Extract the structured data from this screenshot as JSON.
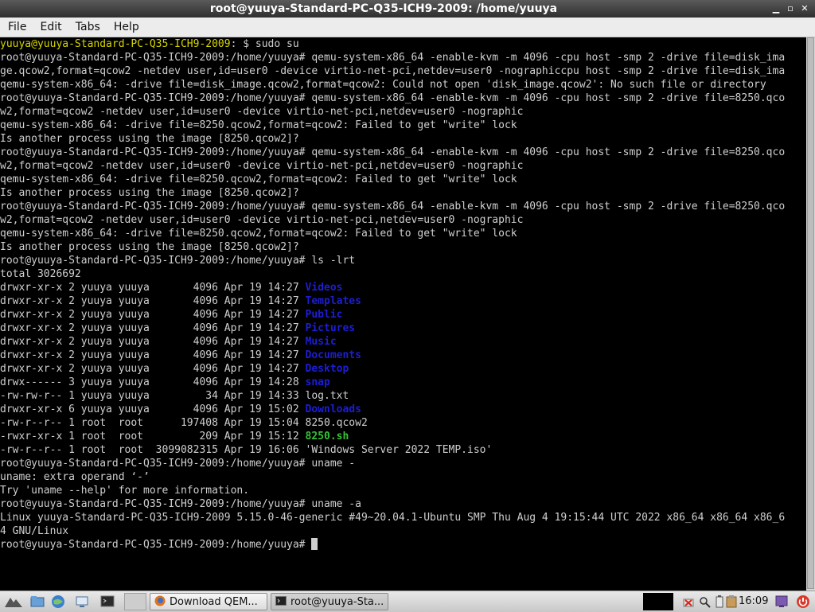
{
  "window": {
    "title": "root@yuuya-Standard-PC-Q35-ICH9-2009: /home/yuuya"
  },
  "menu": {
    "file": "File",
    "edit": "Edit",
    "tabs": "Tabs",
    "help": "Help"
  },
  "terminal": {
    "user_prompt_user": "yuuya@yuuya-Standard-PC-Q35-ICH9-2009",
    "user_prompt_rest": ": $ sudo su",
    "lines": [
      "root@yuuya-Standard-PC-Q35-ICH9-2009:/home/yuuya# qemu-system-x86_64 -enable-kvm -m 4096 -cpu host -smp 2 -drive file=disk_ima",
      "ge.qcow2,format=qcow2 -netdev user,id=user0 -device virtio-net-pci,netdev=user0 -nographiccpu host -smp 2 -drive file=disk_ima",
      "qemu-system-x86_64: -drive file=disk_image.qcow2,format=qcow2: Could not open 'disk_image.qcow2': No such file or directory",
      "root@yuuya-Standard-PC-Q35-ICH9-2009:/home/yuuya# qemu-system-x86_64 -enable-kvm -m 4096 -cpu host -smp 2 -drive file=8250.qco",
      "w2,format=qcow2 -netdev user,id=user0 -device virtio-net-pci,netdev=user0 -nographic",
      "qemu-system-x86_64: -drive file=8250.qcow2,format=qcow2: Failed to get \"write\" lock",
      "Is another process using the image [8250.qcow2]?",
      "root@yuuya-Standard-PC-Q35-ICH9-2009:/home/yuuya# qemu-system-x86_64 -enable-kvm -m 4096 -cpu host -smp 2 -drive file=8250.qco",
      "w2,format=qcow2 -netdev user,id=user0 -device virtio-net-pci,netdev=user0 -nographic",
      "qemu-system-x86_64: -drive file=8250.qcow2,format=qcow2: Failed to get \"write\" lock",
      "Is another process using the image [8250.qcow2]?",
      "root@yuuya-Standard-PC-Q35-ICH9-2009:/home/yuuya# qemu-system-x86_64 -enable-kvm -m 4096 -cpu host -smp 2 -drive file=8250.qco",
      "w2,format=qcow2 -netdev user,id=user0 -device virtio-net-pci,netdev=user0 -nographic",
      "qemu-system-x86_64: -drive file=8250.qcow2,format=qcow2: Failed to get \"write\" lock",
      "Is another process using the image [8250.qcow2]?",
      "root@yuuya-Standard-PC-Q35-ICH9-2009:/home/yuuya# ls -lrt",
      "total 3026692"
    ],
    "listing": [
      {
        "meta": "drwxr-xr-x 2 yuuya yuuya       4096 Apr 19 14:27 ",
        "name": "Videos",
        "kind": "dir"
      },
      {
        "meta": "drwxr-xr-x 2 yuuya yuuya       4096 Apr 19 14:27 ",
        "name": "Templates",
        "kind": "dir"
      },
      {
        "meta": "drwxr-xr-x 2 yuuya yuuya       4096 Apr 19 14:27 ",
        "name": "Public",
        "kind": "dir"
      },
      {
        "meta": "drwxr-xr-x 2 yuuya yuuya       4096 Apr 19 14:27 ",
        "name": "Pictures",
        "kind": "dir"
      },
      {
        "meta": "drwxr-xr-x 2 yuuya yuuya       4096 Apr 19 14:27 ",
        "name": "Music",
        "kind": "dir"
      },
      {
        "meta": "drwxr-xr-x 2 yuuya yuuya       4096 Apr 19 14:27 ",
        "name": "Documents",
        "kind": "dir"
      },
      {
        "meta": "drwxr-xr-x 2 yuuya yuuya       4096 Apr 19 14:27 ",
        "name": "Desktop",
        "kind": "dir"
      },
      {
        "meta": "drwx------ 3 yuuya yuuya       4096 Apr 19 14:28 ",
        "name": "snap",
        "kind": "dir"
      },
      {
        "meta": "-rw-rw-r-- 1 yuuya yuuya         34 Apr 19 14:33 ",
        "name": "log.txt",
        "kind": "file"
      },
      {
        "meta": "drwxr-xr-x 6 yuuya yuuya       4096 Apr 19 15:02 ",
        "name": "Downloads",
        "kind": "dir"
      },
      {
        "meta": "-rw-r--r-- 1 root  root      197408 Apr 19 15:04 ",
        "name": "8250.qcow2",
        "kind": "file"
      },
      {
        "meta": "-rwxr-xr-x 1 root  root         209 Apr 19 15:12 ",
        "name": "8250.sh",
        "kind": "exe"
      },
      {
        "meta": "-rw-r--r-- 1 root  root  3099082315 Apr 19 16:06 ",
        "name": "'Windows Server 2022 TEMP.iso'",
        "kind": "file"
      }
    ],
    "after_lines": [
      "root@yuuya-Standard-PC-Q35-ICH9-2009:/home/yuuya# uname -",
      "uname: extra operand ‘-’",
      "Try 'uname --help' for more information.",
      "root@yuuya-Standard-PC-Q35-ICH9-2009:/home/yuuya# uname -a",
      "Linux yuuya-Standard-PC-Q35-ICH9-2009 5.15.0-46-generic #49~20.04.1-Ubuntu SMP Thu Aug 4 19:15:44 UTC 2022 x86_64 x86_64 x86_6",
      "4 GNU/Linux"
    ],
    "final_prompt": "root@yuuya-Standard-PC-Q35-ICH9-2009:/home/yuuya# "
  },
  "taskbar": {
    "tasks": [
      {
        "label": "Download QEM...",
        "icon": "firefox-icon"
      },
      {
        "label": "root@yuuya-Sta...",
        "icon": "terminal-icon"
      }
    ],
    "clock": "16:09"
  },
  "colors": {
    "prompt_user": "#d6d600",
    "directory": "#1d1dd6",
    "executable": "#36c236",
    "text": "#cfcfcf"
  }
}
